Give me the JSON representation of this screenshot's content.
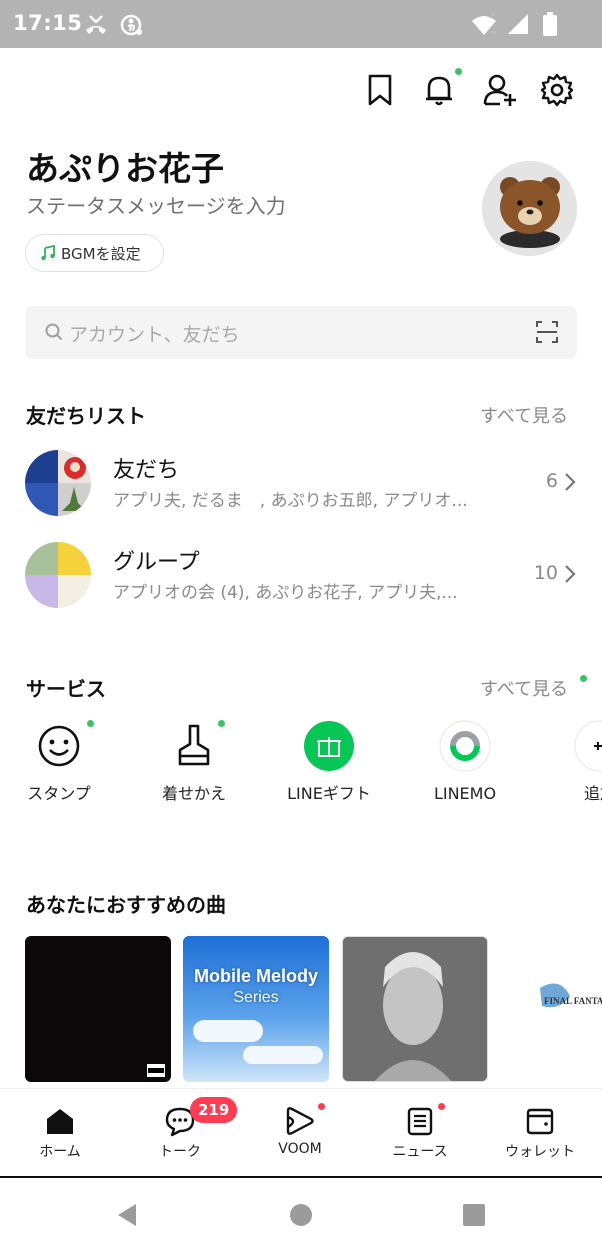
{
  "status_bar": {
    "time": "17:15"
  },
  "profile": {
    "name": "あぷりお花子",
    "status_placeholder": "ステータスメッセージを入力",
    "bgm_label": "BGMを設定"
  },
  "search": {
    "placeholder": "アカウント、友だち"
  },
  "friends_section": {
    "title": "友だちリスト",
    "see_all": "すべて見る",
    "rows": [
      {
        "title": "友だち",
        "subtitle": "アプリ夫, だるま　, あぷりお五郎, アプリオ...",
        "count": "6"
      },
      {
        "title": "グループ",
        "subtitle": "アプリオの会 (4), あぷりお花子, アプリ夫,...",
        "count": "10"
      }
    ]
  },
  "services_section": {
    "title": "サービス",
    "see_all": "すべて見る",
    "items": [
      {
        "label": "スタンプ",
        "icon": "smiley-icon"
      },
      {
        "label": "着せかえ",
        "icon": "brush-icon"
      },
      {
        "label": "LINEギフト",
        "icon": "gift-icon"
      },
      {
        "label": "LINEMO",
        "icon": "linemo-icon"
      },
      {
        "label": "追加",
        "icon": "add-icon"
      }
    ]
  },
  "songs_section": {
    "title": "あなたにおすすめの曲"
  },
  "song_covers": {
    "mobile_melody_line1": "Mobile Melody",
    "mobile_melody_line2": "Series",
    "ff_logo": "FINAL FANTASY"
  },
  "tabs": [
    {
      "label": "ホーム",
      "icon": "home-icon"
    },
    {
      "label": "トーク",
      "icon": "chat-icon",
      "badge": "219"
    },
    {
      "label": "VOOM",
      "icon": "voom-icon"
    },
    {
      "label": "ニュース",
      "icon": "news-icon"
    },
    {
      "label": "ウォレット",
      "icon": "wallet-icon"
    }
  ],
  "colors": {
    "accent_green": "#06c755",
    "badge_red": "#ff3d52",
    "status_bar": "#b3b3b3"
  }
}
